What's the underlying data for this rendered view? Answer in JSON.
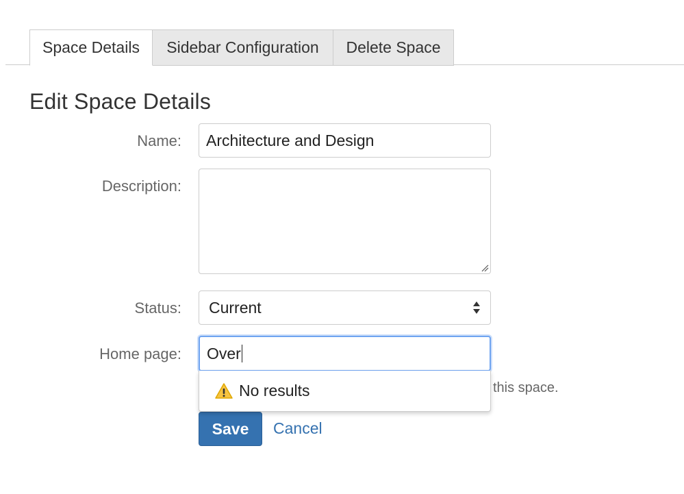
{
  "tabs": [
    {
      "label": "Space Details",
      "active": true
    },
    {
      "label": "Sidebar Configuration",
      "active": false
    },
    {
      "label": "Delete Space",
      "active": false
    }
  ],
  "heading": "Edit Space Details",
  "form": {
    "name_label": "Name:",
    "name_value": "Architecture and Design",
    "description_label": "Description:",
    "description_value": "",
    "status_label": "Status:",
    "status_value": "Current",
    "home_page_label": "Home page:",
    "home_page_value": "Over",
    "home_page_hint": "this space."
  },
  "autocomplete": {
    "icon": "warning-icon",
    "message": "No results"
  },
  "actions": {
    "save_label": "Save",
    "cancel_label": "Cancel"
  },
  "colors": {
    "primary": "#3572b0",
    "focus_ring": "#6fa4f0",
    "warning": "#f6c342"
  }
}
